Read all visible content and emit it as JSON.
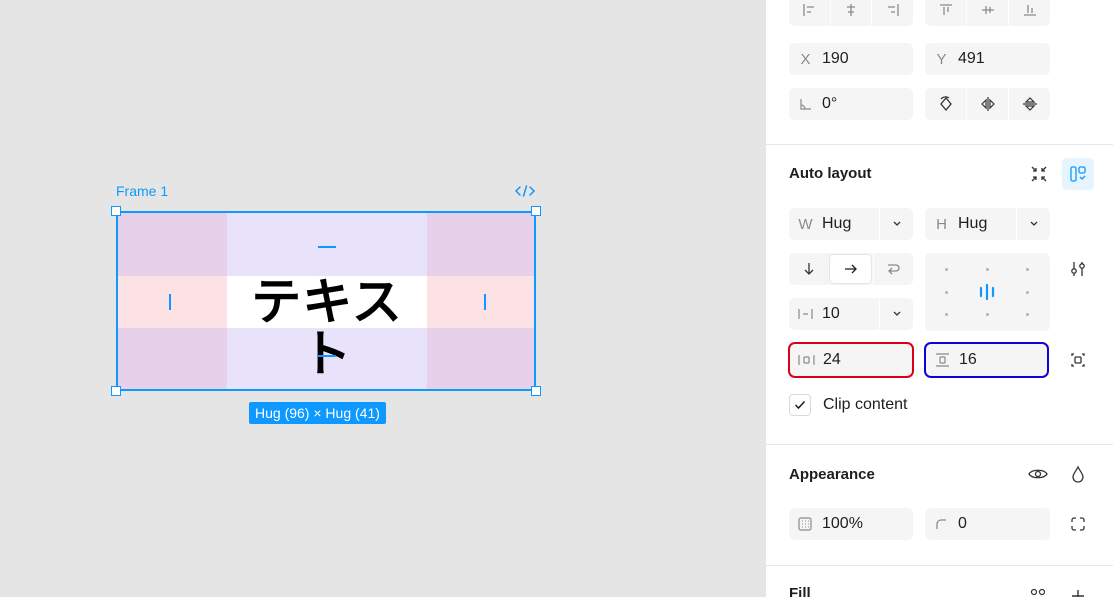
{
  "canvas": {
    "frame_name": "Frame 1",
    "frame_text": "テキスト",
    "size_badge": "Hug (96) × Hug (41)"
  },
  "panel": {
    "position": {
      "x_label": "X",
      "x_value": "190",
      "y_label": "Y",
      "y_value": "491"
    },
    "rotation": {
      "value": "0°"
    },
    "auto_layout": {
      "title": "Auto layout",
      "width": {
        "label": "W",
        "value": "Hug"
      },
      "height": {
        "label": "H",
        "value": "Hug"
      },
      "gap": {
        "value": "10"
      },
      "horizontal_padding": {
        "value": "24"
      },
      "vertical_padding": {
        "value": "16"
      },
      "clip_content_label": "Clip content",
      "clip_content_checked": true
    },
    "appearance": {
      "title": "Appearance",
      "opacity": "100%",
      "corner_radius": "0"
    },
    "fill": {
      "title": "Fill"
    }
  },
  "colors": {
    "selection": "#0d99ff",
    "highlight_red": "#d9001b",
    "highlight_blue": "#1200d6"
  }
}
